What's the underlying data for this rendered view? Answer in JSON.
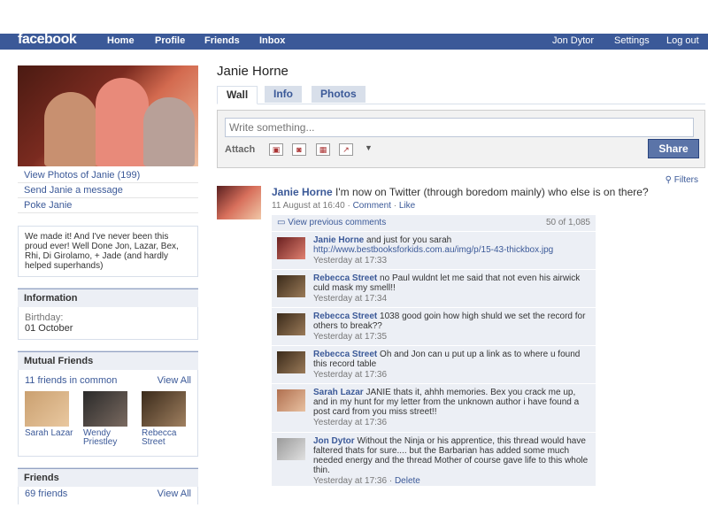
{
  "nav": {
    "logo": "facebook",
    "links": [
      "Home",
      "Profile",
      "Friends",
      "Inbox"
    ],
    "user": "Jon Dytor",
    "settings": "Settings",
    "logout": "Log out"
  },
  "left": {
    "links": [
      "View Photos of Janie (199)",
      "Send Janie a message",
      "Poke Janie"
    ],
    "bio": "We made it! And I've never been this proud ever! Well Done Jon, Lazar, Bex, Rhi, Di Girolamo, + Jade (and hardly helped superhands)",
    "information": {
      "title": "Information",
      "birthday_label": "Birthday:",
      "birthday_value": "01 October"
    },
    "mutual": {
      "title": "Mutual Friends",
      "count": "11 friends in common",
      "view_all": "View All",
      "friends": [
        {
          "name": "Sarah Lazar"
        },
        {
          "name": "Wendy Priestley"
        },
        {
          "name": "Rebecca Street"
        }
      ]
    },
    "friends": {
      "title": "Friends",
      "count": "69 friends",
      "view_all": "View All"
    }
  },
  "main": {
    "name": "Janie Horne",
    "tabs": [
      "Wall",
      "Info",
      "Photos"
    ],
    "composer": {
      "placeholder": "Write something...",
      "attach": "Attach",
      "share": "Share"
    },
    "filters": "Filters",
    "story": {
      "author": "Janie Horne",
      "text": "I'm now on Twitter (through boredom mainly) who else is on there?",
      "time": "11 August at 16:40",
      "comment_link": "Comment",
      "like_link": "Like",
      "sep": "·"
    },
    "previous_comments": {
      "label": "View previous comments",
      "count": "50 of 1,085"
    },
    "comments": [
      {
        "author": "Janie Horne",
        "text": "and just for you sarah",
        "link": "http://www.bestbooksforkids.com.au/img/p/15-43-thickbox.jpg",
        "time": "Yesterday at 17:33"
      },
      {
        "author": "Rebecca Street",
        "text": "no Paul wuldnt let me said that not even his airwick culd mask my smell!!",
        "time": "Yesterday at 17:34"
      },
      {
        "author": "Rebecca Street",
        "text": "1038 good goin how high shuld we set the record for others to break??",
        "time": "Yesterday at 17:35"
      },
      {
        "author": "Rebecca Street",
        "text": "Oh and Jon can u put up a link as to where u found this record table",
        "time": "Yesterday at 17:36"
      },
      {
        "author": "Sarah Lazar",
        "text": "JANIE thats it, ahhh memories. Bex you crack me up, and in my hunt for my letter from the unknown author i have found a post card from you miss street!!",
        "time": "Yesterday at 17:36"
      },
      {
        "author": "Jon Dytor",
        "text": "Without the Ninja or his apprentice, this thread would have faltered thats for sure.... but the Barbarian has added some much needed energy and the thread Mother of course gave life to this whole thin.",
        "time": "Yesterday at 17:36",
        "delete": "Delete"
      }
    ]
  }
}
